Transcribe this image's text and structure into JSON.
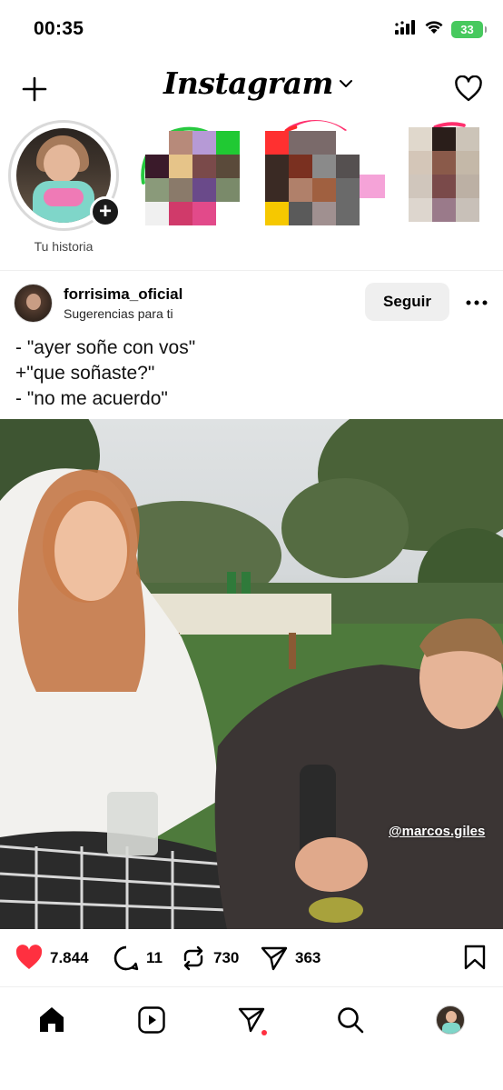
{
  "status_bar": {
    "time": "00:35",
    "battery": "33",
    "icons": [
      "signal-icon",
      "wifi-icon",
      "battery-icon"
    ]
  },
  "header": {
    "logo": "Instagram",
    "icons": [
      "plus-icon",
      "chevron-down-icon",
      "heart-icon"
    ]
  },
  "stories": {
    "own_label": "Tu historia",
    "ring_colors": [
      "#27c93f",
      "#ff2f6d",
      "#ff2f6d"
    ]
  },
  "post": {
    "username": "forrisima_oficial",
    "subtitle": "Sugerencias para ti",
    "follow_label": "Seguir",
    "caption": [
      "- \"ayer soñe con vos\"",
      "+\"que soñaste?\"",
      "- \"no me acuerdo\""
    ],
    "tag": "@marcos.giles",
    "likes": "7.844",
    "comments": "11",
    "reposts": "730",
    "shares": "363",
    "like_color": "#ff3040"
  },
  "bottom_nav": {
    "items": [
      "home-icon",
      "reels-icon",
      "direct-icon",
      "search-icon",
      "profile-avatar"
    ],
    "notification_dot_color": "#ff3040"
  }
}
